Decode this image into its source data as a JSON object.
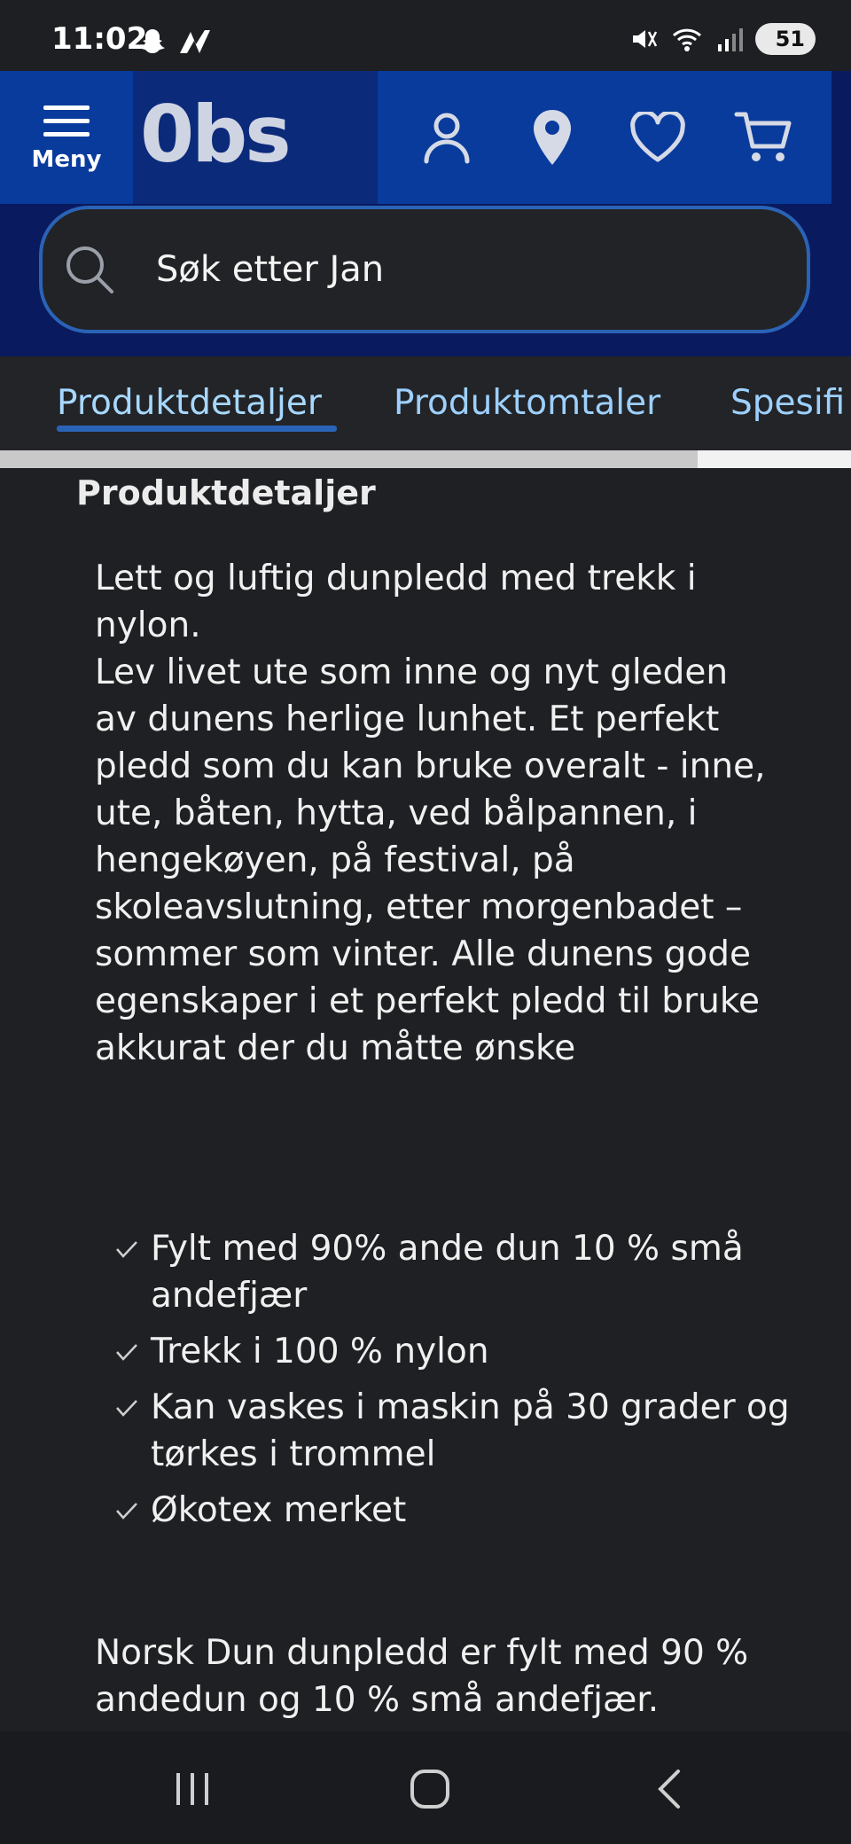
{
  "status_bar": {
    "time": "11:02",
    "battery": "51"
  },
  "header": {
    "menu_label": "Meny",
    "logo_text": "0bs"
  },
  "search": {
    "placeholder": "Søk etter Jan"
  },
  "tabs": [
    {
      "label": "Produktdetaljer",
      "active": true
    },
    {
      "label": "Produktomtaler",
      "active": false
    },
    {
      "label": "Spesifi",
      "active": false
    }
  ],
  "scroll_progress": 0.82,
  "section": {
    "title": "Produktdetaljer",
    "description": "Lett og luftig dunpledd med trekk i nylon.\nLev livet ute som inne og nyt gleden av dunens herlige lunhet. Et perfekt pledd som du kan bruke overalt - inne, ute, båten, hytta, ved bålpannen, i hengekøyen, på festival, på skoleavslutning, etter morgenbadet – sommer som vinter. Alle dunens gode egenskaper i et perfekt pledd til bruke akkurat der du måtte ønske",
    "bullets": [
      "Fylt med 90% ande dun 10 % små andefjær",
      "Trekk i 100 % nylon",
      "Kan vaskes i maskin på 30 grader og tørkes i trommel",
      "Økotex merket"
    ],
    "footer": "Norsk Dun dunpledd er fylt med 90 % andedun og 10 % små andefjær."
  },
  "colors": {
    "header_blue": "#083b9c",
    "dark_navy": "#0a1a5e",
    "tab_text": "#9dd0ff",
    "accent": "#2a63b6"
  }
}
